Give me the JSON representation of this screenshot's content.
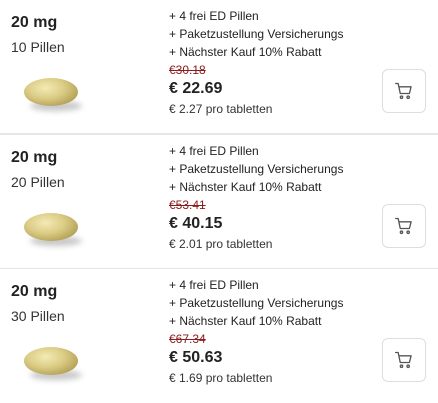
{
  "offers": [
    {
      "dose": "20 mg",
      "count": "10 Pillen",
      "perks": [
        "+ 4 frei ED Pillen",
        "+ Paketzustellung Versicherungs",
        "+ Nächster Kauf 10% Rabatt"
      ],
      "old_price": "€30.18",
      "price": "€ 22.69",
      "unit_price": "€ 2.27 pro tabletten",
      "cart_icon": "shopping-cart-icon"
    },
    {
      "dose": "20 mg",
      "count": "20 Pillen",
      "perks": [
        "+ 4 frei ED Pillen",
        "+ Paketzustellung Versicherungs",
        "+ Nächster Kauf 10% Rabatt"
      ],
      "old_price": "€53.41",
      "price": "€ 40.15",
      "unit_price": "€ 2.01 pro tabletten",
      "cart_icon": "shopping-cart-icon"
    },
    {
      "dose": "20 mg",
      "count": "30 Pillen",
      "perks": [
        "+ 4 frei ED Pillen",
        "+ Paketzustellung Versicherungs",
        "+ Nächster Kauf 10% Rabatt"
      ],
      "old_price": "€67.34",
      "price": "€ 50.63",
      "unit_price": "€ 1.69 pro tabletten",
      "cart_icon": "shopping-cart-icon"
    }
  ],
  "colors": {
    "old_price": "#8a1c1c",
    "border": "#e6e6e6"
  }
}
